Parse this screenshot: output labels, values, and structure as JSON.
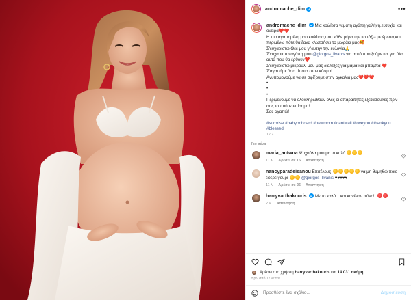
{
  "post": {
    "author": "andromache_dim",
    "more_label": "•••",
    "caption_lines": [
      "Μια κοιλίτσα γεμάτη αγάπη,γαλήνη,ευτυχία και όνειρα❤️❤️",
      "Η πιο αγαπημένη μου κοιλίτσα,που κάθε μέρα την κοιτάζω με έρωτα,και περιμένω πότε θα ξανα κλωτσήσει το μωράκι μας🥰",
      "Σ'ευχαριστώ Θεέ μου γι'αυτήν την ευλογία🙏",
      "Σ'ευχαριστώ αγάπη μου",
      "για αυτό που ζούμε και για όλα αυτά που θα έρθουν❤️",
      "Σ'ευχαριστώ μικρούλι μου μας διάλεξες για μαμά και μπαμπά ❤️",
      "Σ'αγαπάμε όσο τίποτα στον κόσμο!",
      "Ανυπομονούμε να σε σφίξουμε στην αγκαλιά μας❤️❤️❤️",
      "•",
      "•",
      "•",
      "Περιμένουμε να ολοκληρωθούν όλες οι απαραίτητες εξετασούλες πριν σας το πούμε επίσημα!",
      "Σας αγαπώ!"
    ],
    "caption_mention": "@giorgos_livanis",
    "hashtags": "#surprise #babyonboard #newmom #cantwait #loveyou #thankyou #blessed",
    "caption_age": "17 λ.",
    "translate_label": "Για σένα",
    "colors": {
      "verified": "#0095f6",
      "background": "#b0141f",
      "link": "#385185",
      "like": "#ed4956"
    }
  },
  "comments": [
    {
      "user": "maria_antwna",
      "text": "Ψυχούλα μου με το καλό",
      "age": "11 λ.",
      "likes": "Αρέσει σε 16",
      "reply": "Απάντηση",
      "avatar_icon": "profile-photo"
    },
    {
      "user": "nancyparadeisanou",
      "text_before": "Επιτέλους",
      "text_middle": "να μη θυμηθώ ποιο έφερε γούρι",
      "mention": "@giorgos_livanis",
      "text_after": "♥♥♥♥♥",
      "age": "11 λ.",
      "likes": "Αρέσει σε 26",
      "reply": "Απάντηση",
      "avatar_icon": "profile-photo"
    },
    {
      "user": "harryvarthakouris",
      "text": "Με το καλό... και κανέναν πόνο!!",
      "age": "2 λ.",
      "reply": "Απάντηση",
      "avatar_icon": "profile-photo"
    }
  ],
  "actions": {
    "icons": [
      "heart-icon",
      "comment-icon",
      "share-icon",
      "bookmark-icon"
    ],
    "likes_prefix": "Αρέσει στο χρήστη",
    "likes_user": "harryvarthakouris",
    "likes_middle": "και",
    "likes_count": "14.031 ακόμη",
    "posted": "πριν από 17 λεπτά"
  },
  "add_comment": {
    "placeholder": "Προσθέστε ένα σχόλιο...",
    "post_label": "Δημοσίευση",
    "icon": "emoji-icon"
  }
}
